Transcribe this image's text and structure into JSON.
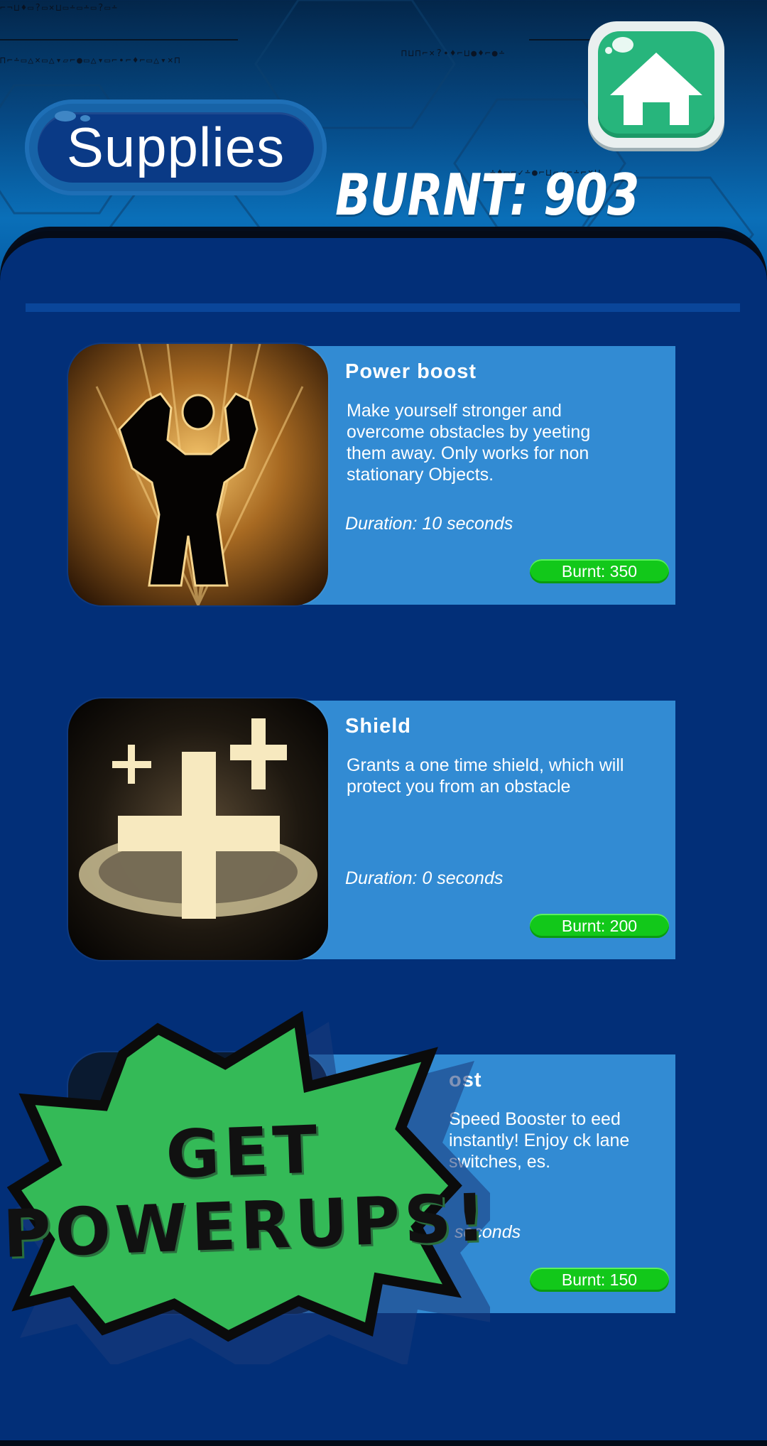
{
  "header": {
    "title": "Supplies",
    "burnt_counter": "BURNT: 903",
    "home_icon": "home-icon"
  },
  "colors": {
    "background": "#042f78",
    "card": "#328bd3",
    "price_button": "#12c81a",
    "home_button": "#27b57c",
    "promo": "#34ba57"
  },
  "powerups": [
    {
      "title": "Power boost",
      "description": "Make yourself stronger and overcome obstacles by yeeting them away. Only works for non stationary Objects.",
      "duration": "Duration: 10 seconds",
      "price": "Burnt: 350",
      "icon": "strongman-icon"
    },
    {
      "title": "Shield",
      "description": "Grants a one time shield, which will protect you from an obstacle",
      "duration": "Duration: 0 seconds",
      "price": "Burnt: 200",
      "icon": "shield-cross-icon"
    },
    {
      "title": "ost",
      "description": "Speed Booster to eed instantly! Enjoy ck lane switches, es.",
      "duration": "seconds",
      "price": "Burnt: 150",
      "icon": "speed-icon"
    }
  ],
  "promo": {
    "line1": "GET",
    "line2": "POWERUPS!"
  }
}
